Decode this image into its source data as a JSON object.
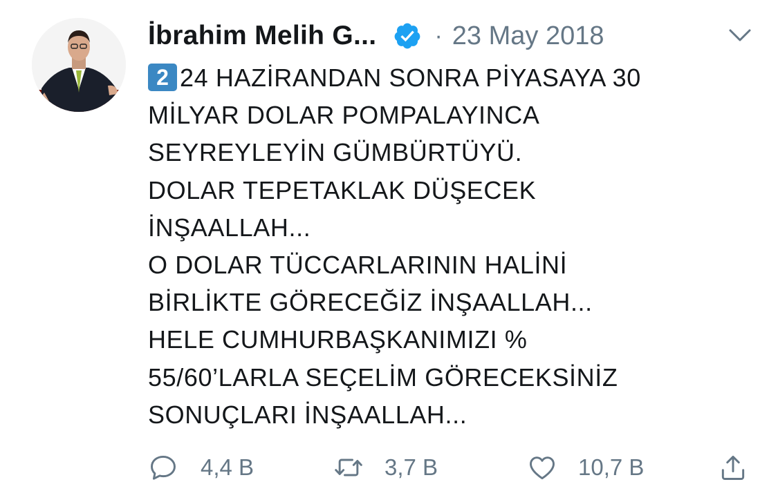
{
  "tweet": {
    "author_name": "İbrahim Melih G...",
    "separator": "·",
    "date": "23 May 2018",
    "keycap_number": "2",
    "lines": [
      "24 HAZİRANDAN SONRA PİYASAYA 30",
      "MİLYAR DOLAR POMPALAYINCA",
      "SEYREYLEYİN GÜMBÜRTÜYÜ.",
      "DOLAR TEPETAKLAK DÜŞECEK",
      "İNŞAALLAH...",
      "O DOLAR TÜCCARLARININ HALİNİ",
      "BİRLİKTE GÖRECEĞİZ İNŞAALLAH...",
      "HELE CUMHURBAŞKANIMIZI %",
      "55/60’LARLA SEÇELİM GÖRECEKSİNİZ",
      "SONUÇLARI İNŞAALLAH..."
    ]
  },
  "actions": {
    "replies": "4,4 B",
    "retweets": "3,7 B",
    "likes": "10,7 B"
  },
  "icons": {
    "verified": "verified-badge-icon",
    "caret": "chevron-down-icon",
    "reply": "reply-icon",
    "retweet": "retweet-icon",
    "like": "heart-icon",
    "share": "share-icon"
  },
  "colors": {
    "text": "#14171a",
    "muted": "#657786",
    "verified_blue": "#1da1f2",
    "keycap_blue": "#3b88c3"
  }
}
